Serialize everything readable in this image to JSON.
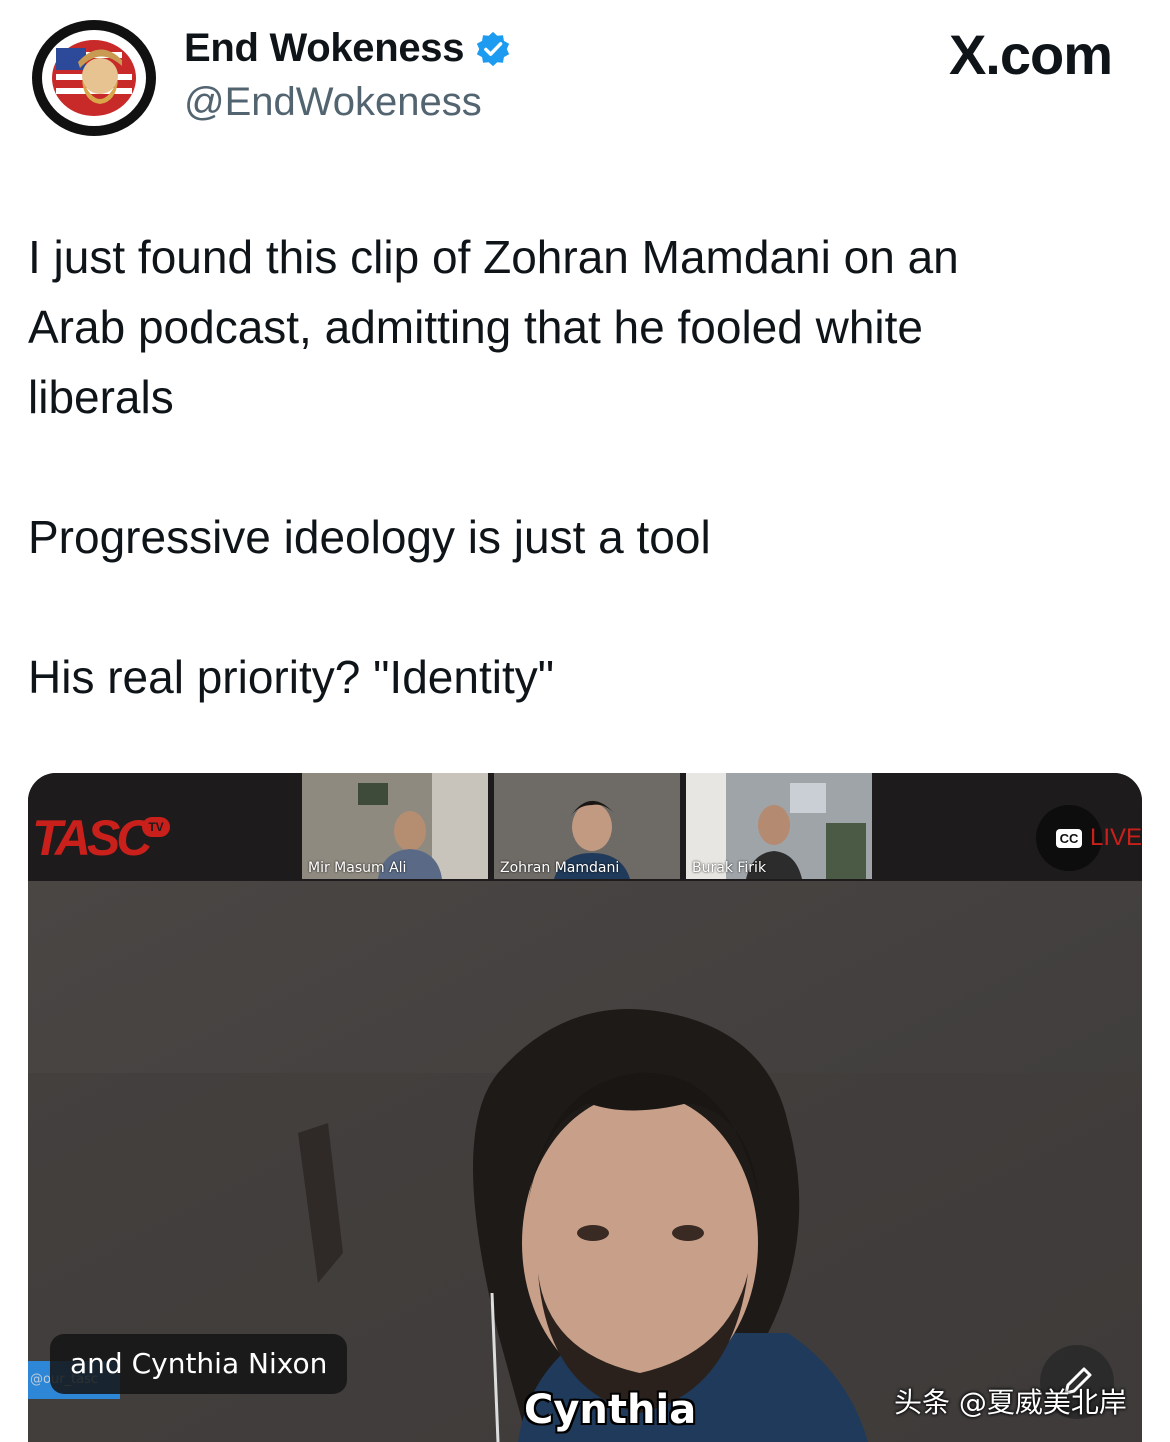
{
  "post": {
    "author": {
      "display_name": "End Wokeness",
      "handle": "@EndWokeness",
      "verified": true,
      "avatar_icon": "support-former-things-badge-icon"
    },
    "brand": "X.com",
    "text_lines": [
      "I just found this clip of Zohran Mamdani on an",
      "Arab podcast, admitting that he fooled white",
      "liberals"
    ],
    "text_paragraph_2": "Progressive ideology is just a tool",
    "text_paragraph_3": "His real priority? \"Identity\""
  },
  "video": {
    "channel_logo": "TASC",
    "channel_logo_tv": "TV",
    "participants": [
      "Mir Masum Ali",
      "Zohran Mamdani",
      "Burak Firik"
    ],
    "cc_label": "CC",
    "live_label": "LIVE",
    "caption": "and Cynthia Nixon",
    "handle_tag": "@our_tasc",
    "subtitle": "Cynthia",
    "watermark": "头条 @夏威美北岸"
  },
  "colors": {
    "verified_blue": "#1d9bf0",
    "tasc_red": "#c9201c",
    "handle_gray": "#536471"
  }
}
